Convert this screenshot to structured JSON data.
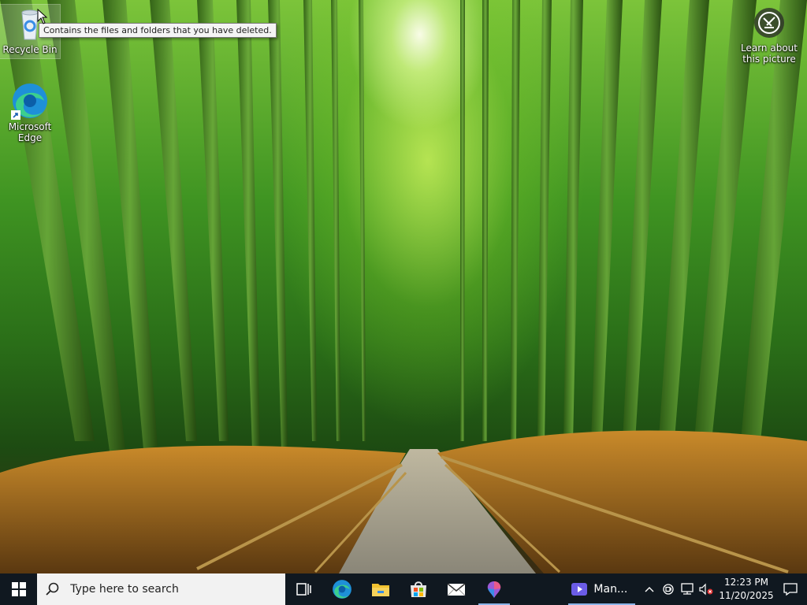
{
  "desktop": {
    "icons": [
      {
        "label": "Recycle Bin",
        "icon": "recycle-bin-icon"
      },
      {
        "label": "Microsoft Edge",
        "icon": "edge-icon"
      }
    ],
    "tooltip": "Contains the files and folders that you have deleted.",
    "spotlight": {
      "label": "Learn about this picture",
      "icon": "camera-icon"
    }
  },
  "taskbar": {
    "search_placeholder": "Type here to search",
    "pinned": [
      {
        "name": "task-view",
        "icon": "task-view-icon"
      },
      {
        "name": "edge",
        "icon": "edge-icon"
      },
      {
        "name": "file-explorer",
        "icon": "folder-icon"
      },
      {
        "name": "microsoft-store",
        "icon": "store-icon"
      },
      {
        "name": "mail",
        "icon": "mail-icon"
      },
      {
        "name": "paint-3d",
        "icon": "paint-icon"
      }
    ],
    "running_task": {
      "label": "Man...",
      "icon": "video-icon"
    },
    "tray": {
      "icons": [
        "chevron-up-icon",
        "meet-now-icon",
        "network-icon",
        "volume-muted-icon"
      ],
      "time": "12:23 PM",
      "date": "11/20/2025"
    },
    "colors": {
      "bar": "#101820",
      "accent": "#8ab4e8"
    }
  }
}
